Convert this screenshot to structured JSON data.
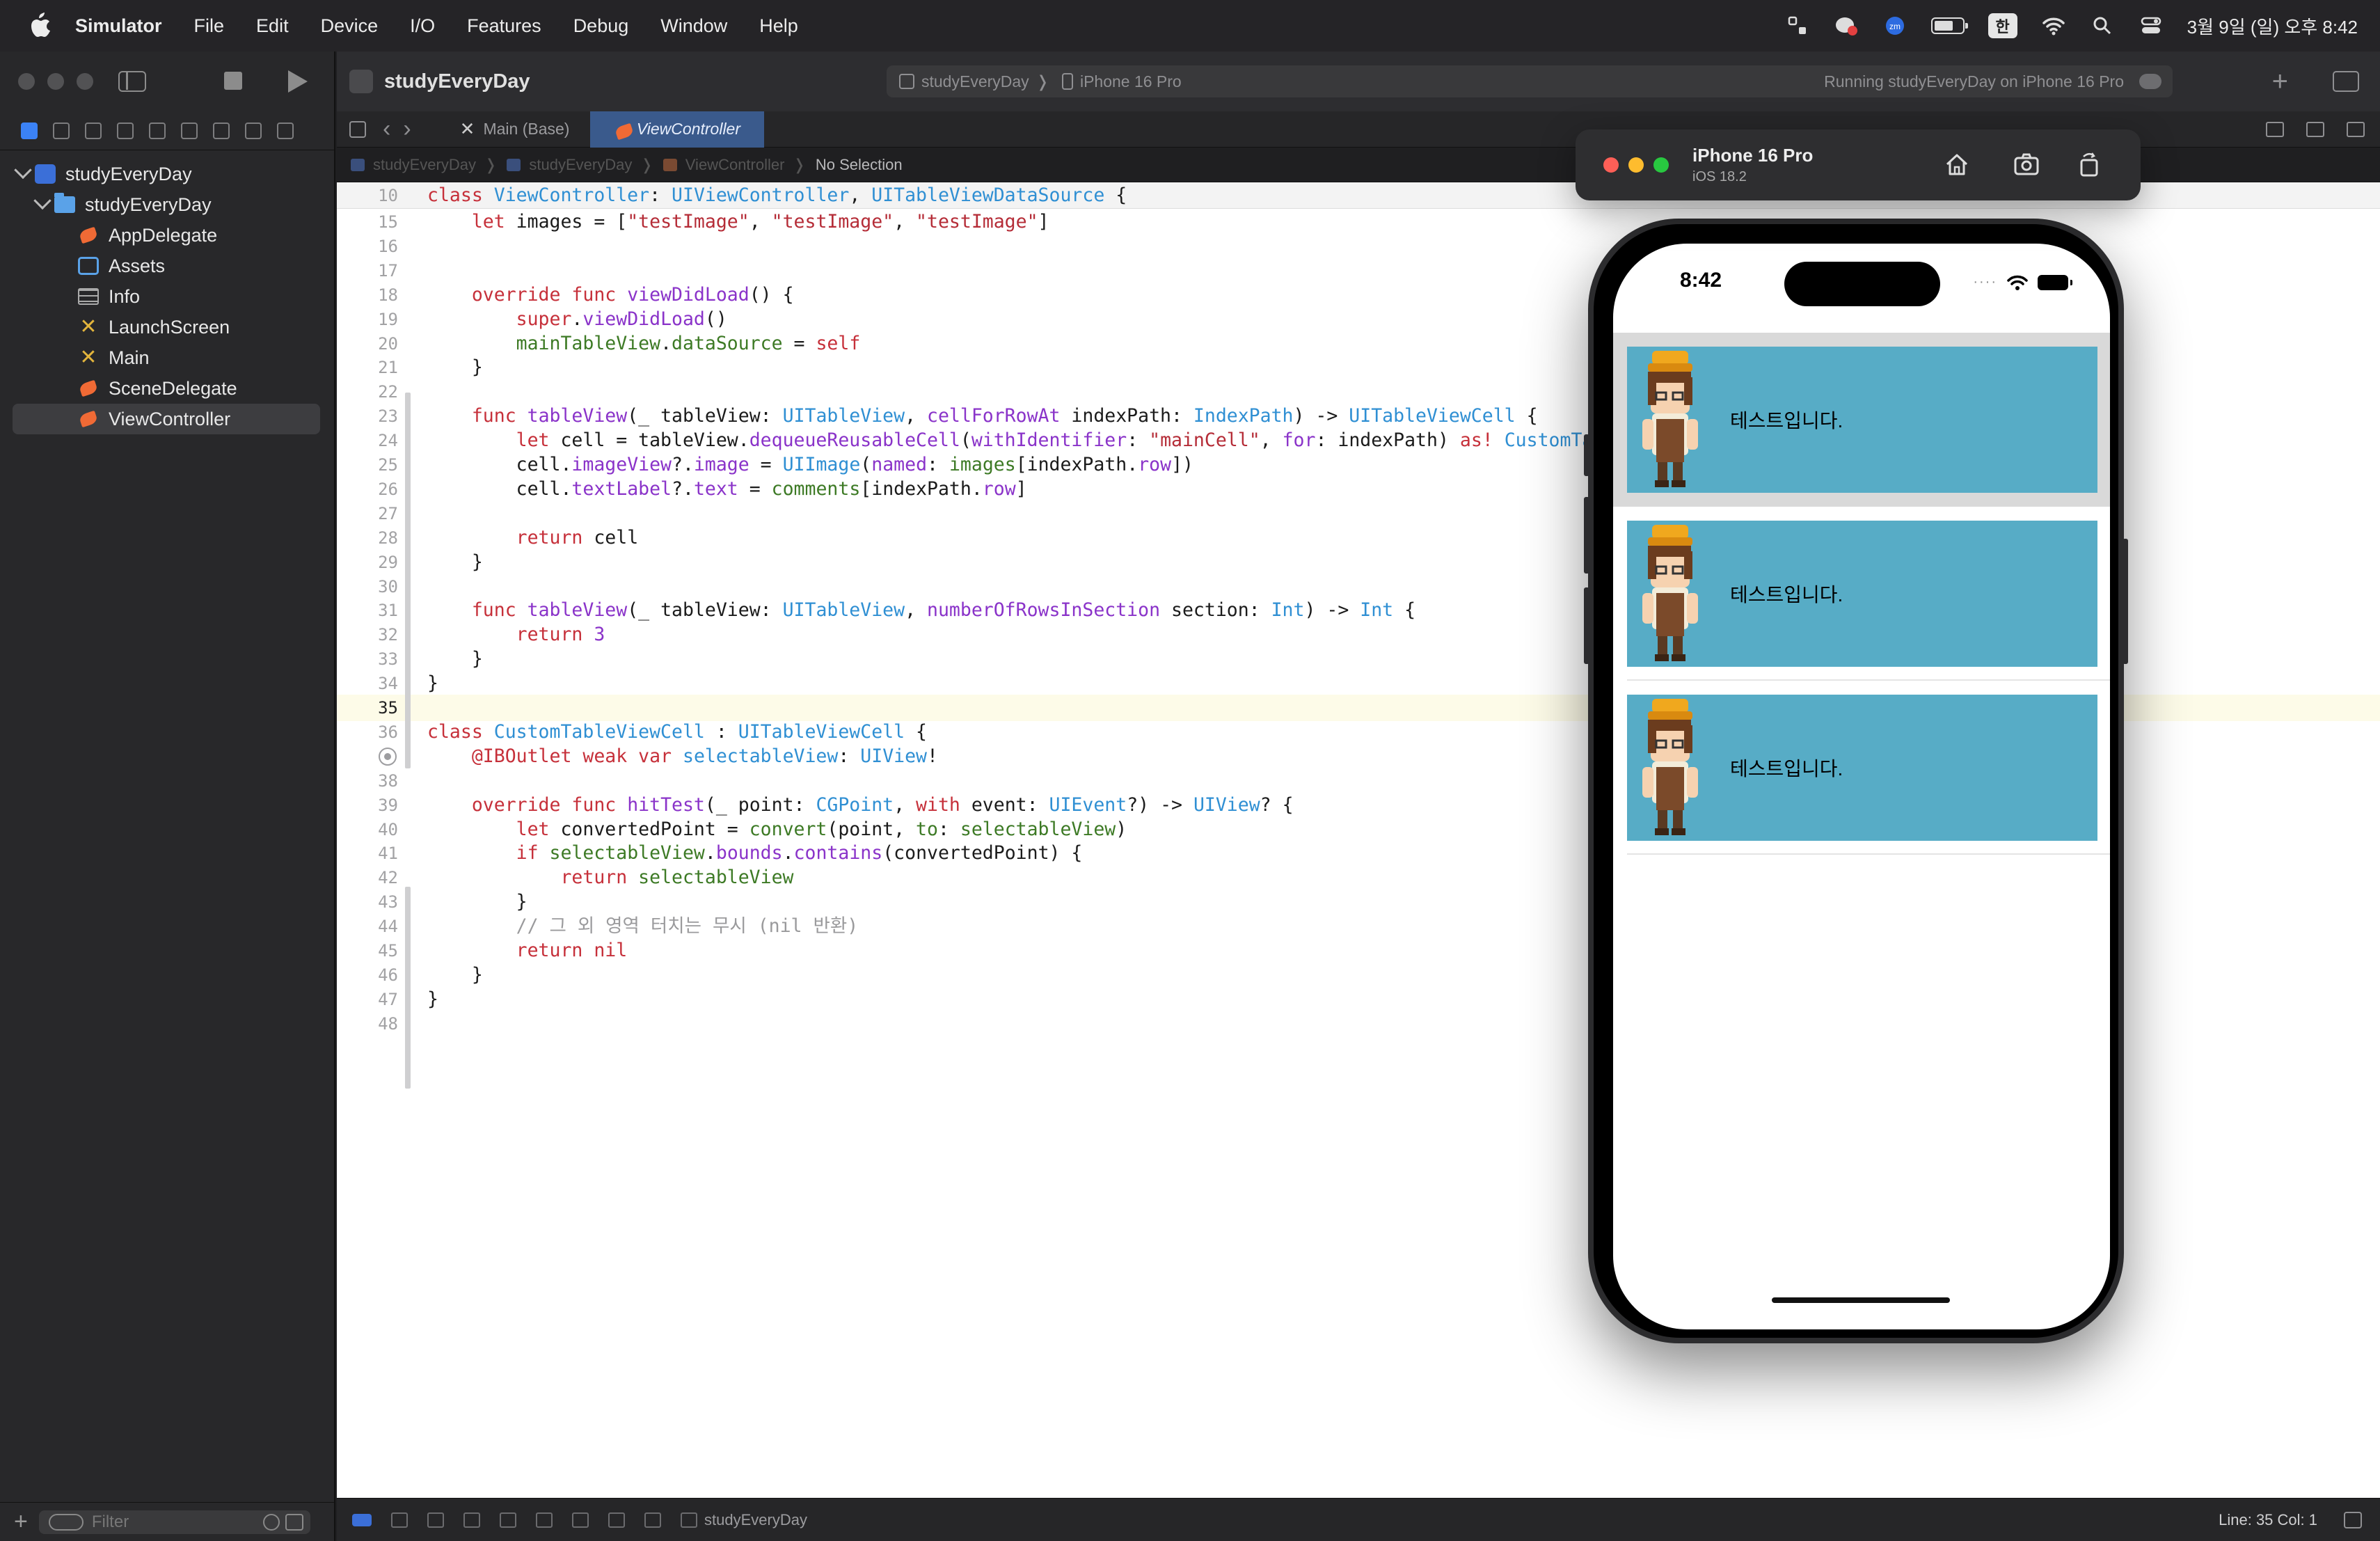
{
  "menubar": {
    "app_name": "Simulator",
    "items": [
      "File",
      "Edit",
      "Device",
      "I/O",
      "Features",
      "Debug",
      "Window",
      "Help"
    ],
    "status": {
      "ime_badge": "한",
      "clock": "3월 9일 (일) 오후 8:42",
      "battery_level": 0.7,
      "icons": [
        "bracket-icon",
        "messenger-icon",
        "zoom-icon",
        "battery-icon",
        "wifi-icon",
        "search-icon",
        "control-center-icon"
      ]
    }
  },
  "toolbar": {
    "project_title": "studyEveryDay",
    "scheme_name": "studyEveryDay",
    "device_name": "iPhone 16 Pro",
    "run_status": "Running studyEveryDay on iPhone 16 Pro"
  },
  "tabs": [
    {
      "label": "Main (Base)",
      "active": false
    },
    {
      "label": "ViewController",
      "active": true
    }
  ],
  "jumpbar": {
    "crumbs": [
      "studyEveryDay",
      "studyEveryDay",
      "ViewController"
    ],
    "selection": "No Selection"
  },
  "navigator": {
    "project": "studyEveryDay",
    "group": "studyEveryDay",
    "files": [
      {
        "name": "AppDelegate",
        "icon": "swift-file-icon"
      },
      {
        "name": "Assets",
        "icon": "assets-icon"
      },
      {
        "name": "Info",
        "icon": "plist-icon"
      },
      {
        "name": "LaunchScreen",
        "icon": "storyboard-icon"
      },
      {
        "name": "Main",
        "icon": "storyboard-icon"
      },
      {
        "name": "SceneDelegate",
        "icon": "swift-file-icon"
      },
      {
        "name": "ViewController",
        "icon": "swift-file-icon",
        "selected": true
      }
    ],
    "filter_placeholder": "Filter"
  },
  "code": {
    "sticky": {
      "ln": "10",
      "tokens": [
        [
          "kw",
          "class "
        ],
        [
          "ty",
          "ViewController"
        ],
        [
          "",
          ": "
        ],
        [
          "ty",
          "UIViewController"
        ],
        [
          "",
          ", "
        ],
        [
          "ty",
          "UITableViewDataSource"
        ],
        [
          "",
          " {"
        ]
      ]
    },
    "lines": [
      {
        "ln": "15",
        "tokens": [
          [
            "",
            "    "
          ],
          [
            "kw",
            "let"
          ],
          [
            "",
            " images = ["
          ],
          [
            "st",
            "\"testImage\""
          ],
          [
            "",
            ", "
          ],
          [
            "st",
            "\"testImage\""
          ],
          [
            "",
            ", "
          ],
          [
            "st",
            "\"testImage\""
          ],
          [
            "",
            "]"
          ]
        ]
      },
      {
        "ln": "16",
        "tokens": []
      },
      {
        "ln": "17",
        "tokens": []
      },
      {
        "ln": "18",
        "tokens": [
          [
            "",
            "    "
          ],
          [
            "kw",
            "override func "
          ],
          [
            "fn",
            "viewDidLoad"
          ],
          [
            "",
            "() {"
          ]
        ]
      },
      {
        "ln": "19",
        "tokens": [
          [
            "",
            "        "
          ],
          [
            "kw",
            "super"
          ],
          [
            "",
            "."
          ],
          [
            "nm",
            "viewDidLoad"
          ],
          [
            "",
            "()"
          ]
        ]
      },
      {
        "ln": "20",
        "tokens": [
          [
            "",
            "        "
          ],
          [
            "pr",
            "mainTableView"
          ],
          [
            "",
            "."
          ],
          [
            "pr",
            "dataSource"
          ],
          [
            "",
            " = "
          ],
          [
            "kw",
            "self"
          ]
        ]
      },
      {
        "ln": "21",
        "tokens": [
          [
            "",
            "    }"
          ]
        ]
      },
      {
        "ln": "22",
        "tokens": []
      },
      {
        "ln": "23",
        "tokens": [
          [
            "",
            "    "
          ],
          [
            "kw",
            "func "
          ],
          [
            "fn",
            "tableView"
          ],
          [
            "",
            "(_ tableView: "
          ],
          [
            "ty",
            "UITableView"
          ],
          [
            "",
            ", "
          ],
          [
            "fn",
            "cellForRowAt"
          ],
          [
            "",
            " indexPath: "
          ],
          [
            "ty",
            "IndexPath"
          ],
          [
            "",
            ") -> "
          ],
          [
            "ty",
            "UITableViewCell"
          ],
          [
            "",
            " {"
          ]
        ]
      },
      {
        "ln": "24",
        "tokens": [
          [
            "",
            "        "
          ],
          [
            "kw",
            "let"
          ],
          [
            "",
            " cell = tableView."
          ],
          [
            "nm",
            "dequeueReusableCell"
          ],
          [
            "",
            "("
          ],
          [
            "nm",
            "withIdentifier"
          ],
          [
            "",
            ": "
          ],
          [
            "st",
            "\"mainCell\""
          ],
          [
            "",
            ", "
          ],
          [
            "nm",
            "for"
          ],
          [
            "",
            ": indexPath) "
          ],
          [
            "kw",
            "as!"
          ],
          [
            "",
            " "
          ],
          [
            "ty",
            "CustomTableViewCell"
          ]
        ]
      },
      {
        "ln": "25",
        "tokens": [
          [
            "",
            "        cell."
          ],
          [
            "nm",
            "imageView"
          ],
          [
            "",
            "?."
          ],
          [
            "nm",
            "image"
          ],
          [
            "",
            " = "
          ],
          [
            "ty",
            "UIImage"
          ],
          [
            "",
            "("
          ],
          [
            "nm",
            "named"
          ],
          [
            "",
            ": "
          ],
          [
            "pr",
            "images"
          ],
          [
            "",
            "[indexPath."
          ],
          [
            "nm",
            "row"
          ],
          [
            "",
            "])"
          ]
        ]
      },
      {
        "ln": "26",
        "tokens": [
          [
            "",
            "        cell."
          ],
          [
            "nm",
            "textLabel"
          ],
          [
            "",
            "?."
          ],
          [
            "nm",
            "text"
          ],
          [
            "",
            " = "
          ],
          [
            "pr",
            "comments"
          ],
          [
            "",
            "[indexPath."
          ],
          [
            "nm",
            "row"
          ],
          [
            "",
            "]"
          ]
        ]
      },
      {
        "ln": "27",
        "tokens": []
      },
      {
        "ln": "28",
        "tokens": [
          [
            "",
            "        "
          ],
          [
            "kw",
            "return"
          ],
          [
            "",
            " cell"
          ]
        ]
      },
      {
        "ln": "29",
        "tokens": [
          [
            "",
            "    }"
          ]
        ]
      },
      {
        "ln": "30",
        "tokens": []
      },
      {
        "ln": "31",
        "tokens": [
          [
            "",
            "    "
          ],
          [
            "kw",
            "func "
          ],
          [
            "fn",
            "tableView"
          ],
          [
            "",
            "(_ tableView: "
          ],
          [
            "ty",
            "UITableView"
          ],
          [
            "",
            ", "
          ],
          [
            "fn",
            "numberOfRowsInSection"
          ],
          [
            "",
            " section: "
          ],
          [
            "ty",
            "Int"
          ],
          [
            "",
            ") -> "
          ],
          [
            "ty",
            "Int"
          ],
          [
            "",
            " {"
          ]
        ]
      },
      {
        "ln": "32",
        "tokens": [
          [
            "",
            "        "
          ],
          [
            "kw",
            "return "
          ],
          [
            "nm",
            "3"
          ]
        ]
      },
      {
        "ln": "33",
        "tokens": [
          [
            "",
            "    }"
          ]
        ]
      },
      {
        "ln": "34",
        "tokens": [
          [
            "",
            "}"
          ]
        ]
      },
      {
        "ln": "35",
        "tokens": [],
        "current": true
      },
      {
        "ln": "36",
        "tokens": [
          [
            "kw",
            "class "
          ],
          [
            "ty",
            "CustomTableViewCell"
          ],
          [
            "",
            " : "
          ],
          [
            "ty",
            "UITableViewCell"
          ],
          [
            "",
            " {"
          ]
        ]
      },
      {
        "ln": "",
        "tokens": [
          [
            "",
            "    "
          ],
          [
            "ib",
            "@IBOutlet"
          ],
          [
            "",
            " "
          ],
          [
            "kw",
            "weak var "
          ],
          [
            "ty",
            "selectableView"
          ],
          [
            "",
            ": "
          ],
          [
            "ty",
            "UIView"
          ],
          [
            "",
            "!"
          ]
        ],
        "breakpoint": true
      },
      {
        "ln": "38",
        "tokens": []
      },
      {
        "ln": "39",
        "tokens": [
          [
            "",
            "    "
          ],
          [
            "kw",
            "override func "
          ],
          [
            "fn",
            "hitTest"
          ],
          [
            "",
            "(_ point: "
          ],
          [
            "ty",
            "CGPoint"
          ],
          [
            "",
            ", "
          ],
          [
            "kw",
            "with"
          ],
          [
            "",
            " event: "
          ],
          [
            "ty",
            "UIEvent"
          ],
          [
            "",
            "?) -> "
          ],
          [
            "ty",
            "UIView"
          ],
          [
            "",
            "? {"
          ]
        ]
      },
      {
        "ln": "40",
        "tokens": [
          [
            "",
            "        "
          ],
          [
            "kw",
            "let"
          ],
          [
            "",
            " convertedPoint = "
          ],
          [
            "pr",
            "convert"
          ],
          [
            "",
            "(point, "
          ],
          [
            "pr",
            "to"
          ],
          [
            "",
            ": "
          ],
          [
            "pr",
            "selectableView"
          ],
          [
            "",
            ")"
          ]
        ]
      },
      {
        "ln": "41",
        "tokens": [
          [
            "",
            "        "
          ],
          [
            "kw",
            "if "
          ],
          [
            "pr",
            "selectableView"
          ],
          [
            "",
            "."
          ],
          [
            "nm",
            "bounds"
          ],
          [
            "",
            "."
          ],
          [
            "nm",
            "contains"
          ],
          [
            "",
            "(convertedPoint) {"
          ]
        ]
      },
      {
        "ln": "42",
        "tokens": [
          [
            "",
            "            "
          ],
          [
            "kw",
            "return "
          ],
          [
            "pr",
            "selectableView"
          ]
        ]
      },
      {
        "ln": "43",
        "tokens": [
          [
            "",
            "        }"
          ]
        ]
      },
      {
        "ln": "44",
        "tokens": [
          [
            "",
            "        "
          ],
          [
            "cm",
            "// 그 외 영역 터치는 무시 (nil 반환)"
          ]
        ]
      },
      {
        "ln": "45",
        "tokens": [
          [
            "",
            "        "
          ],
          [
            "kw",
            "return nil"
          ]
        ]
      },
      {
        "ln": "46",
        "tokens": [
          [
            "",
            "    }"
          ]
        ]
      },
      {
        "ln": "47",
        "tokens": [
          [
            "",
            "}"
          ]
        ]
      },
      {
        "ln": "48",
        "tokens": []
      }
    ]
  },
  "statusbar": {
    "target": "studyEveryDay",
    "cursor": "Line: 35  Col: 1"
  },
  "simulator": {
    "device_title": "iPhone 16 Pro",
    "os": "iOS 18.2",
    "time": "8:42",
    "cells": [
      {
        "label": "테스트입니다.",
        "selected": true
      },
      {
        "label": "테스트입니다.",
        "selected": false
      },
      {
        "label": "테스트입니다.",
        "selected": false
      }
    ]
  }
}
